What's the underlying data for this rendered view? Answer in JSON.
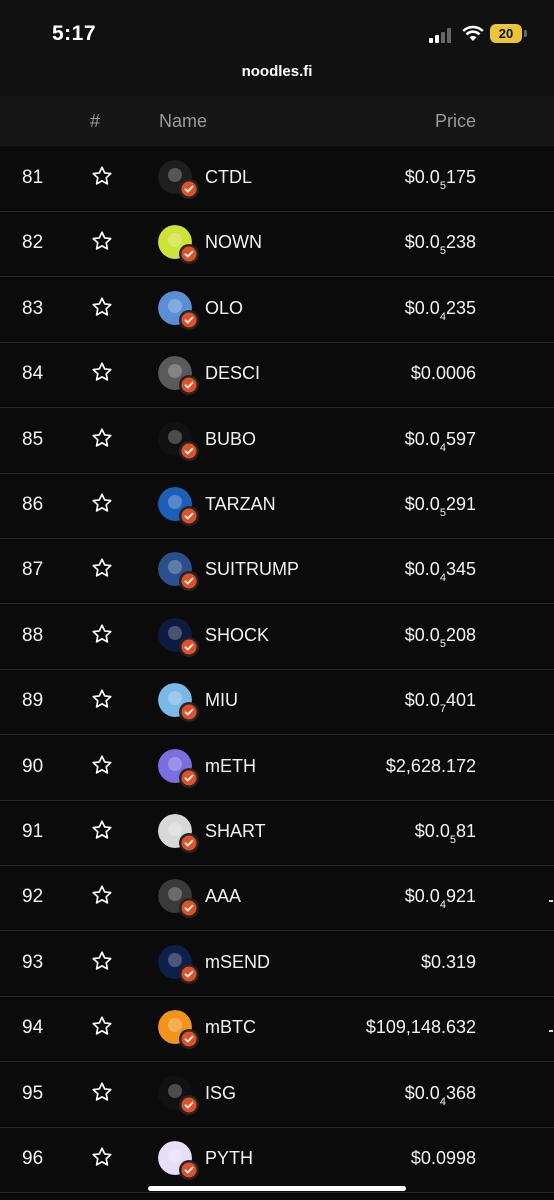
{
  "status_bar": {
    "time": "5:17",
    "battery": "20"
  },
  "browser": {
    "url": "noodles.fi"
  },
  "table": {
    "headers": {
      "rank": "#",
      "name": "Name",
      "price": "Price"
    },
    "rows": [
      {
        "rank": "81",
        "name": "CTDL",
        "price_prefix": "$0.0",
        "price_sub": "5",
        "price_suffix": "175",
        "logo": "ctdl-logo",
        "logo_color": "#1e1e1e"
      },
      {
        "rank": "82",
        "name": "NOWN",
        "price_prefix": "$0.0",
        "price_sub": "5",
        "price_suffix": "238",
        "logo": "nown-logo",
        "logo_color": "#cfe23a"
      },
      {
        "rank": "83",
        "name": "OLO",
        "price_prefix": "$0.0",
        "price_sub": "4",
        "price_suffix": "235",
        "logo": "olo-logo",
        "logo_color": "#5a8fd6"
      },
      {
        "rank": "84",
        "name": "DESCI",
        "price_prefix": "$0.0006",
        "price_sub": "",
        "price_suffix": "",
        "logo": "question-logo",
        "logo_color": "#5a5a5a"
      },
      {
        "rank": "85",
        "name": "BUBO",
        "price_prefix": "$0.0",
        "price_sub": "4",
        "price_suffix": "597",
        "logo": "bubo-logo",
        "logo_color": "#111111"
      },
      {
        "rank": "86",
        "name": "TARZAN",
        "price_prefix": "$0.0",
        "price_sub": "5",
        "price_suffix": "291",
        "logo": "tarzan-logo",
        "logo_color": "#1d5fb8"
      },
      {
        "rank": "87",
        "name": "SUITRUMP",
        "price_prefix": "$0.0",
        "price_sub": "4",
        "price_suffix": "345",
        "logo": "suitrump-logo",
        "logo_color": "#2b4f8a"
      },
      {
        "rank": "88",
        "name": "SHOCK",
        "price_prefix": "$0.0",
        "price_sub": "5",
        "price_suffix": "208",
        "logo": "shock-logo",
        "logo_color": "#0f1a40"
      },
      {
        "rank": "89",
        "name": "MIU",
        "price_prefix": "$0.0",
        "price_sub": "7",
        "price_suffix": "401",
        "logo": "miu-logo",
        "logo_color": "#7ab8e8"
      },
      {
        "rank": "90",
        "name": "mETH",
        "price_prefix": "$2,628.172",
        "price_sub": "",
        "price_suffix": "",
        "logo": "eth-logo",
        "logo_color": "#7b6fe0"
      },
      {
        "rank": "91",
        "name": "SHART",
        "price_prefix": "$0.0",
        "price_sub": "5",
        "price_suffix": "81",
        "logo": "shart-logo",
        "logo_color": "#d8d8d8"
      },
      {
        "rank": "92",
        "name": "AAA",
        "price_prefix": "$0.0",
        "price_sub": "4",
        "price_suffix": "921",
        "logo": "aaa-logo",
        "logo_color": "#3a3a3a"
      },
      {
        "rank": "93",
        "name": "mSEND",
        "price_prefix": "$0.319",
        "price_sub": "",
        "price_suffix": "",
        "logo": "send-logo",
        "logo_color": "#0e1f4a"
      },
      {
        "rank": "94",
        "name": "mBTC",
        "price_prefix": "$109,148.632",
        "price_sub": "",
        "price_suffix": "",
        "logo": "btc-logo",
        "logo_color": "#f2941c"
      },
      {
        "rank": "95",
        "name": "ISG",
        "price_prefix": "$0.0",
        "price_sub": "4",
        "price_suffix": "368",
        "logo": "isg-logo",
        "logo_color": "#111111"
      },
      {
        "rank": "96",
        "name": "PYTH",
        "price_prefix": "$0.0998",
        "price_sub": "",
        "price_suffix": "",
        "logo": "pyth-logo",
        "logo_color": "#e6dff5"
      }
    ]
  },
  "colors": {
    "badge": "#e0512a",
    "background": "#0b0b0b",
    "header": "#161616"
  }
}
